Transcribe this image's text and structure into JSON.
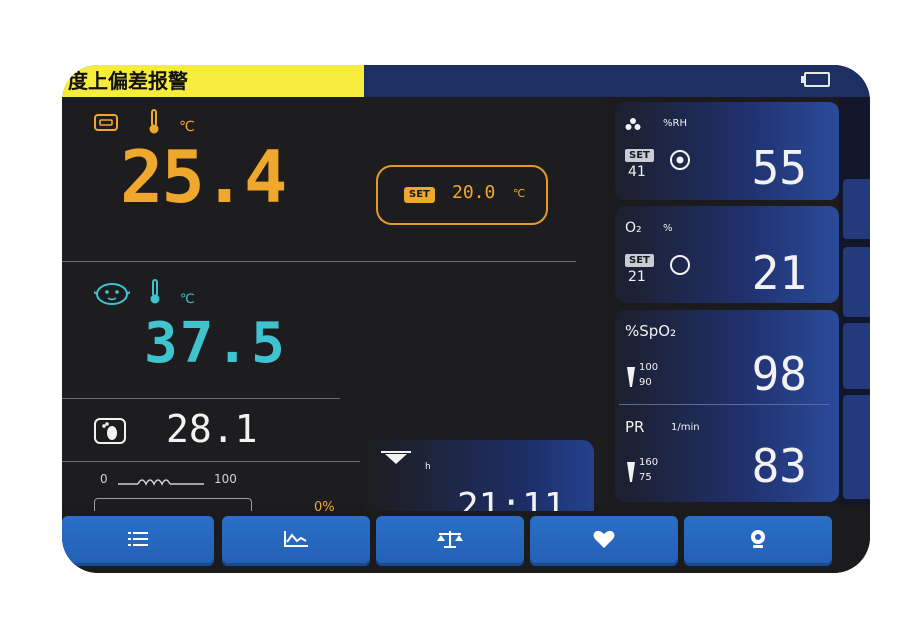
{
  "alarm": {
    "text": "度上偏差报警"
  },
  "skin_temp": {
    "unit": "℃",
    "value": "25.4",
    "set_badge": "SET",
    "set_value": "20.0",
    "set_unit": "℃"
  },
  "baby_temp": {
    "unit": "℃",
    "value": "37.5"
  },
  "foot_temp": {
    "value": "28.1"
  },
  "heater": {
    "scale_min": "0",
    "scale_max": "100",
    "power_pct": 0,
    "power_text": "0%"
  },
  "timer": {
    "unit": "h",
    "value": "21:11"
  },
  "humidity": {
    "label": "%RH",
    "set_badge": "SET",
    "set_value": "41",
    "value": "55"
  },
  "oxygen": {
    "label": "O₂",
    "unit": "%",
    "set_badge": "SET",
    "set_value": "21",
    "value": "21"
  },
  "spo2": {
    "label": "%SpO₂",
    "high": "100",
    "low": "90",
    "value": "98"
  },
  "pulse": {
    "label": "PR",
    "unit": "1/min",
    "high": "160",
    "low": "75",
    "value": "83"
  },
  "nav": {
    "items": [
      "menu-icon",
      "trend-icon",
      "scale-icon",
      "heart-icon",
      "camera-icon"
    ]
  },
  "colors": {
    "orange": "#f0a82c",
    "cyan": "#3fc4cf",
    "alarm_yellow": "#f5ec3c",
    "nav_blue": "#2b6fc7"
  }
}
